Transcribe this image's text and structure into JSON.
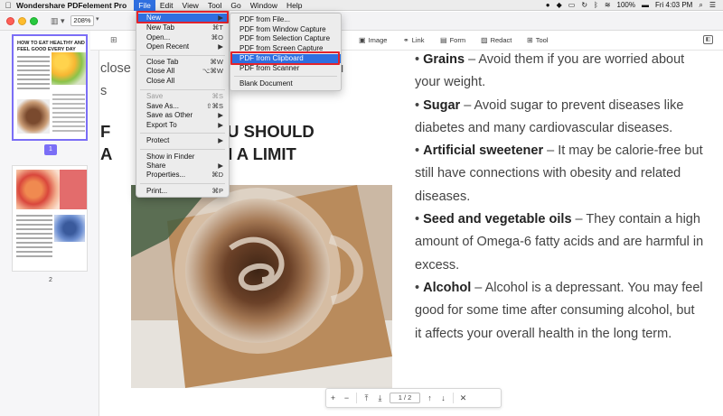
{
  "menubar": {
    "app_name": "Wondershare PDFelement Pro",
    "menus": [
      "File",
      "Edit",
      "View",
      "Tool",
      "Go",
      "Window",
      "Help"
    ],
    "status": {
      "battery": "100%",
      "clock": "Fri 4:03 PM"
    }
  },
  "toolbar": {
    "zoom": "208%",
    "tools": [
      "Image",
      "Link",
      "Form",
      "Redact",
      "Tool"
    ],
    "partial_tool": "xt"
  },
  "thumbnails": {
    "page1_title": "HOW TO EAT HEALTHY AND FEEL GOOD EVERY DAY",
    "page1_number": "1",
    "page2_number": "2"
  },
  "file_menu": {
    "items": [
      {
        "label": "New",
        "shortcut": "▶"
      },
      {
        "label": "New Tab",
        "shortcut": "⌘T"
      },
      {
        "label": "Open...",
        "shortcut": "⌘O"
      },
      {
        "label": "Open Recent",
        "shortcut": "▶"
      },
      {
        "label": "Close Tab",
        "shortcut": "⌘W"
      },
      {
        "label": "Close All",
        "shortcut": "⌥⌘W"
      },
      {
        "label": "Close All",
        "shortcut": ""
      },
      {
        "label": "Save",
        "shortcut": "⌘S"
      },
      {
        "label": "Save As...",
        "shortcut": "⇧⌘S"
      },
      {
        "label": "Save as Other",
        "shortcut": "▶"
      },
      {
        "label": "Export To",
        "shortcut": "▶"
      },
      {
        "label": "Protect",
        "shortcut": "▶"
      },
      {
        "label": "Show in Finder",
        "shortcut": ""
      },
      {
        "label": "Share",
        "shortcut": "▶"
      },
      {
        "label": "Properties...",
        "shortcut": "⌘D"
      },
      {
        "label": "Print...",
        "shortcut": "⌘P"
      }
    ]
  },
  "new_submenu": {
    "items": [
      "PDF from File...",
      "PDF from Window Capture",
      "PDF from Selection Capture",
      "PDF from Screen Capture",
      "PDF from Clipboard",
      "PDF from Scanner",
      "Blank Document"
    ]
  },
  "document": {
    "left_text1_a": "close",
    "left_text1_b": "you",
    "left_text2": "s",
    "left_heading_a": "F",
    "left_heading_b": "T YOU SHOULD",
    "left_heading_c": "A",
    "left_heading_d": "AT IN A LIMIT",
    "bullets": [
      {
        "term": "Grains",
        "text": " – Avoid them if you are worried about your weight."
      },
      {
        "term": "Sugar",
        "text": " – Avoid sugar to prevent diseases like diabetes and many cardiovascular diseases."
      },
      {
        "term": "Artificial sweetener",
        "text": " – It may be calorie-free but still have connections with obesity and related diseases."
      },
      {
        "term": "Seed and vegetable oils",
        "text": " – They contain a high amount of Omega-6 fatty acids and are harmful in excess."
      },
      {
        "term": "Alcohol",
        "text": " – Alcohol is a depressant. You may feel good for some time after consuming alcohol, but it affects your overall health in the long term."
      }
    ]
  },
  "page_nav": {
    "current_page": "1",
    "total_pages": "2"
  }
}
